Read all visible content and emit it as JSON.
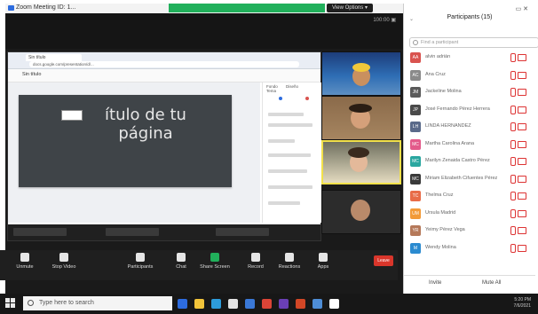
{
  "zoom": {
    "title": "Zoom Meeting ID: 1...",
    "view_button": "View Options ▾",
    "top_right": "100:00  ▣",
    "tool_buttons": [
      {
        "label": "Unmute",
        "icon": "mic-icon"
      },
      {
        "label": "Stop Video",
        "icon": "video-icon"
      },
      {
        "label": "Participants",
        "icon": "participants-icon"
      },
      {
        "label": "Chat",
        "icon": "chat-icon"
      },
      {
        "label": "Share Screen",
        "icon": "share-icon"
      },
      {
        "label": "Record",
        "icon": "record-icon"
      },
      {
        "label": "Reactions",
        "icon": "reactions-icon"
      },
      {
        "label": "Apps",
        "icon": "apps-icon"
      }
    ],
    "leave": "Leave",
    "colors": {
      "share_green": "#21b05b",
      "leave_red": "#d9362b"
    }
  },
  "shared": {
    "tab_label": "Sin título",
    "address": "docs.google.com/presentation/d/...",
    "doc_title": "Sin título",
    "slide_title": "ítulo de tu página",
    "side_tabs": [
      "Fondo",
      "Diseño",
      "Tema"
    ]
  },
  "gallery": [
    {
      "name": ""
    },
    {
      "name": ""
    },
    {
      "name": ""
    },
    {
      "name": ""
    }
  ],
  "participants": {
    "header": "Participants (15)",
    "search_placeholder": "Find a participant",
    "list": [
      {
        "initials": "AA",
        "name": "alvin adrián",
        "color": "#d9534f"
      },
      {
        "initials": "AC",
        "name": "Ana Cruz",
        "color": "#8a8a8a"
      },
      {
        "initials": "JM",
        "name": "Jackeline Molina",
        "color": "#5a5a5a"
      },
      {
        "initials": "JP",
        "name": "José Fernando Pérez Herrera",
        "color": "#4a4a4a"
      },
      {
        "initials": "LH",
        "name": "LINDA HERNANDEZ",
        "color": "#5a6a8a"
      },
      {
        "initials": "MC",
        "name": "Martha Carolina Arana",
        "color": "#e35a8a"
      },
      {
        "initials": "MC",
        "name": "Marilyn Zenaida Castro Pérez",
        "color": "#2aa7a0"
      },
      {
        "initials": "MC",
        "name": "Miriam Elizabeth Cifuentes Pérez",
        "color": "#3a3a3a"
      },
      {
        "initials": "TC",
        "name": "Thelma Cruz",
        "color": "#e86c48"
      },
      {
        "initials": "UM",
        "name": "Ursula Madrid",
        "color": "#f29a38"
      },
      {
        "initials": "YR",
        "name": "Yeimy Pérez Vega",
        "color": "#b5795a"
      },
      {
        "initials": "M",
        "name": "Wendy Molina",
        "color": "#2b8bd0"
      }
    ],
    "bottom_left": "Invite",
    "bottom_right": "Mute All"
  },
  "taskbar": {
    "search_placeholder": "Type here to search",
    "time": "5:20 PM",
    "date": "7/6/2021",
    "app_colors": [
      "#2d6cdf",
      "#f2c43a",
      "#2d9cdb",
      "#e3e3e3",
      "#3a78d6",
      "#db4437",
      "#6a3fb5",
      "#d24726",
      "#4e8dd6",
      "#ffffff"
    ]
  }
}
